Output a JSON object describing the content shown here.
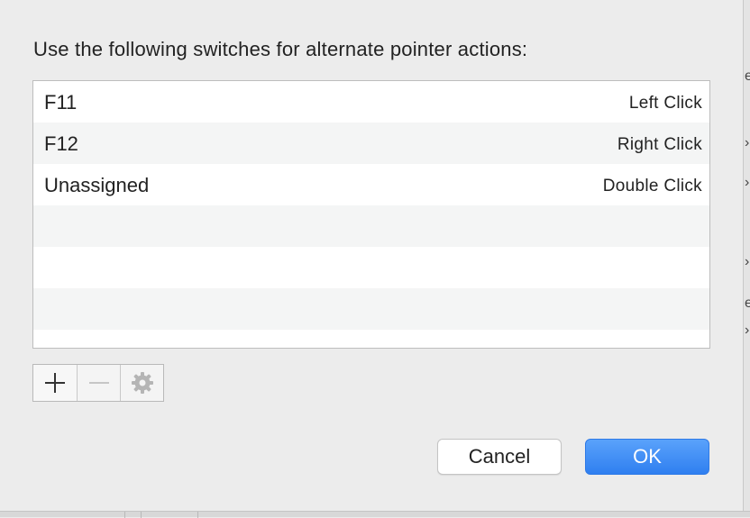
{
  "dialog": {
    "prompt": "Use the following switches for alternate pointer actions:",
    "rows": [
      {
        "key": "F11",
        "action": "Left Click"
      },
      {
        "key": "F12",
        "action": "Right Click"
      },
      {
        "key": "Unassigned",
        "action": "Double Click"
      },
      {
        "key": "",
        "action": ""
      },
      {
        "key": "",
        "action": ""
      },
      {
        "key": "",
        "action": ""
      },
      {
        "key": "",
        "action": ""
      }
    ],
    "toolbar": {
      "add_icon": "plus-icon",
      "remove_icon": "minus-icon",
      "action_icon": "gear-icon"
    },
    "cancel_label": "Cancel",
    "ok_label": "OK"
  },
  "colors": {
    "accent": "#3b89f5",
    "sheet_background": "#ececec",
    "row_alt": "#f4f5f5"
  }
}
